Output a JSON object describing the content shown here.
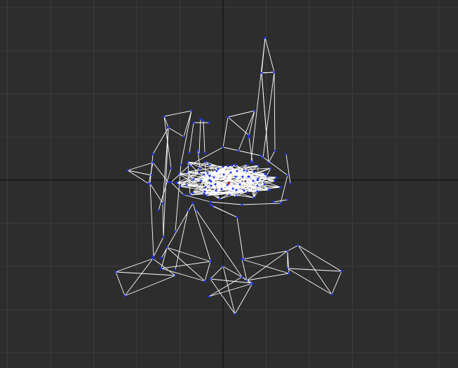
{
  "viewport": {
    "view": "orthographic",
    "display_mode": "wireframe",
    "grid_visible": true,
    "axes_visible": true,
    "colors": {
      "background": "#2d2d2d",
      "grid": "#3c3c3c",
      "axis": "#0a0a0a",
      "edge": "#ffffff",
      "vertex": "#2233ff",
      "pivot": "#cc2222"
    }
  }
}
